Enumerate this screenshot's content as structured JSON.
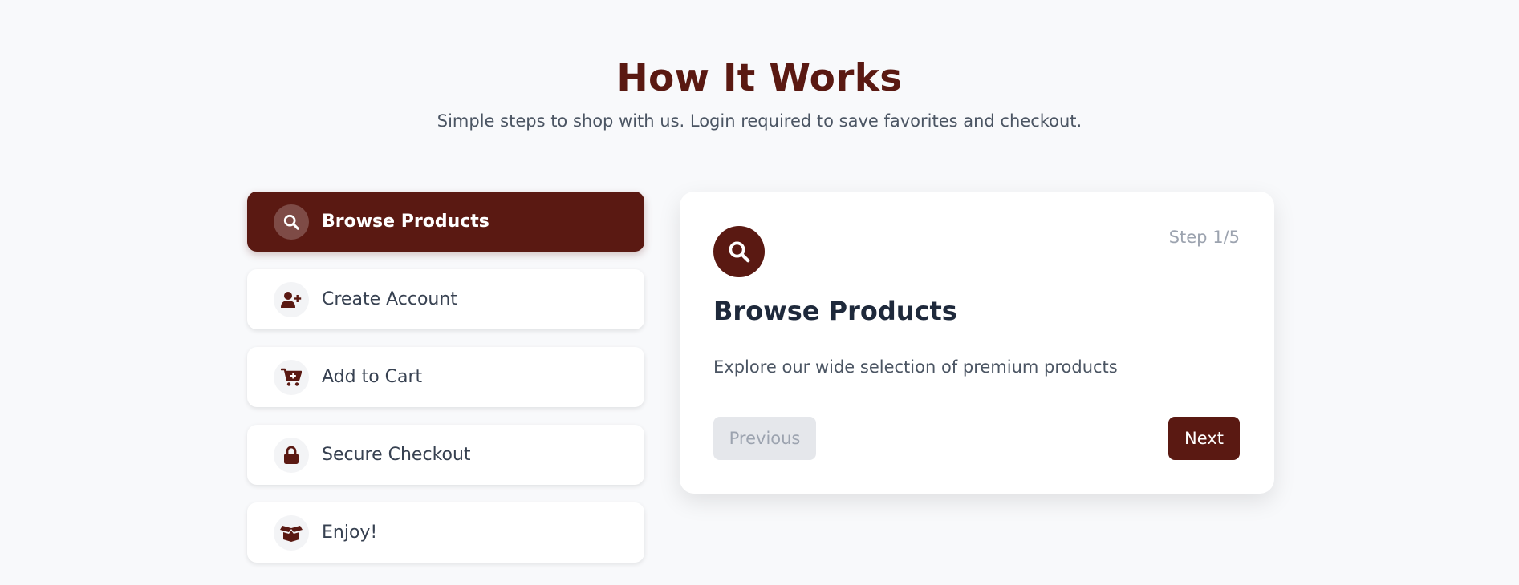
{
  "header": {
    "title": "How It Works",
    "subtitle": "Simple steps to shop with us. Login required to save favorites and checkout."
  },
  "steps": [
    {
      "label": "Browse Products",
      "icon": "search-icon",
      "active": true
    },
    {
      "label": "Create Account",
      "icon": "user-plus-icon",
      "active": false
    },
    {
      "label": "Add to Cart",
      "icon": "cart-plus-icon",
      "active": false
    },
    {
      "label": "Secure Checkout",
      "icon": "lock-icon",
      "active": false
    },
    {
      "label": "Enjoy!",
      "icon": "open-box-icon",
      "active": false
    }
  ],
  "detail": {
    "icon": "search-icon",
    "step_counter": "Step 1/5",
    "title": "Browse Products",
    "description": "Explore our wide selection of premium products",
    "prev_label": "Previous",
    "next_label": "Next"
  },
  "colors": {
    "accent": "#5a1912",
    "background": "#f8f9fb",
    "muted": "#9ca3af"
  }
}
